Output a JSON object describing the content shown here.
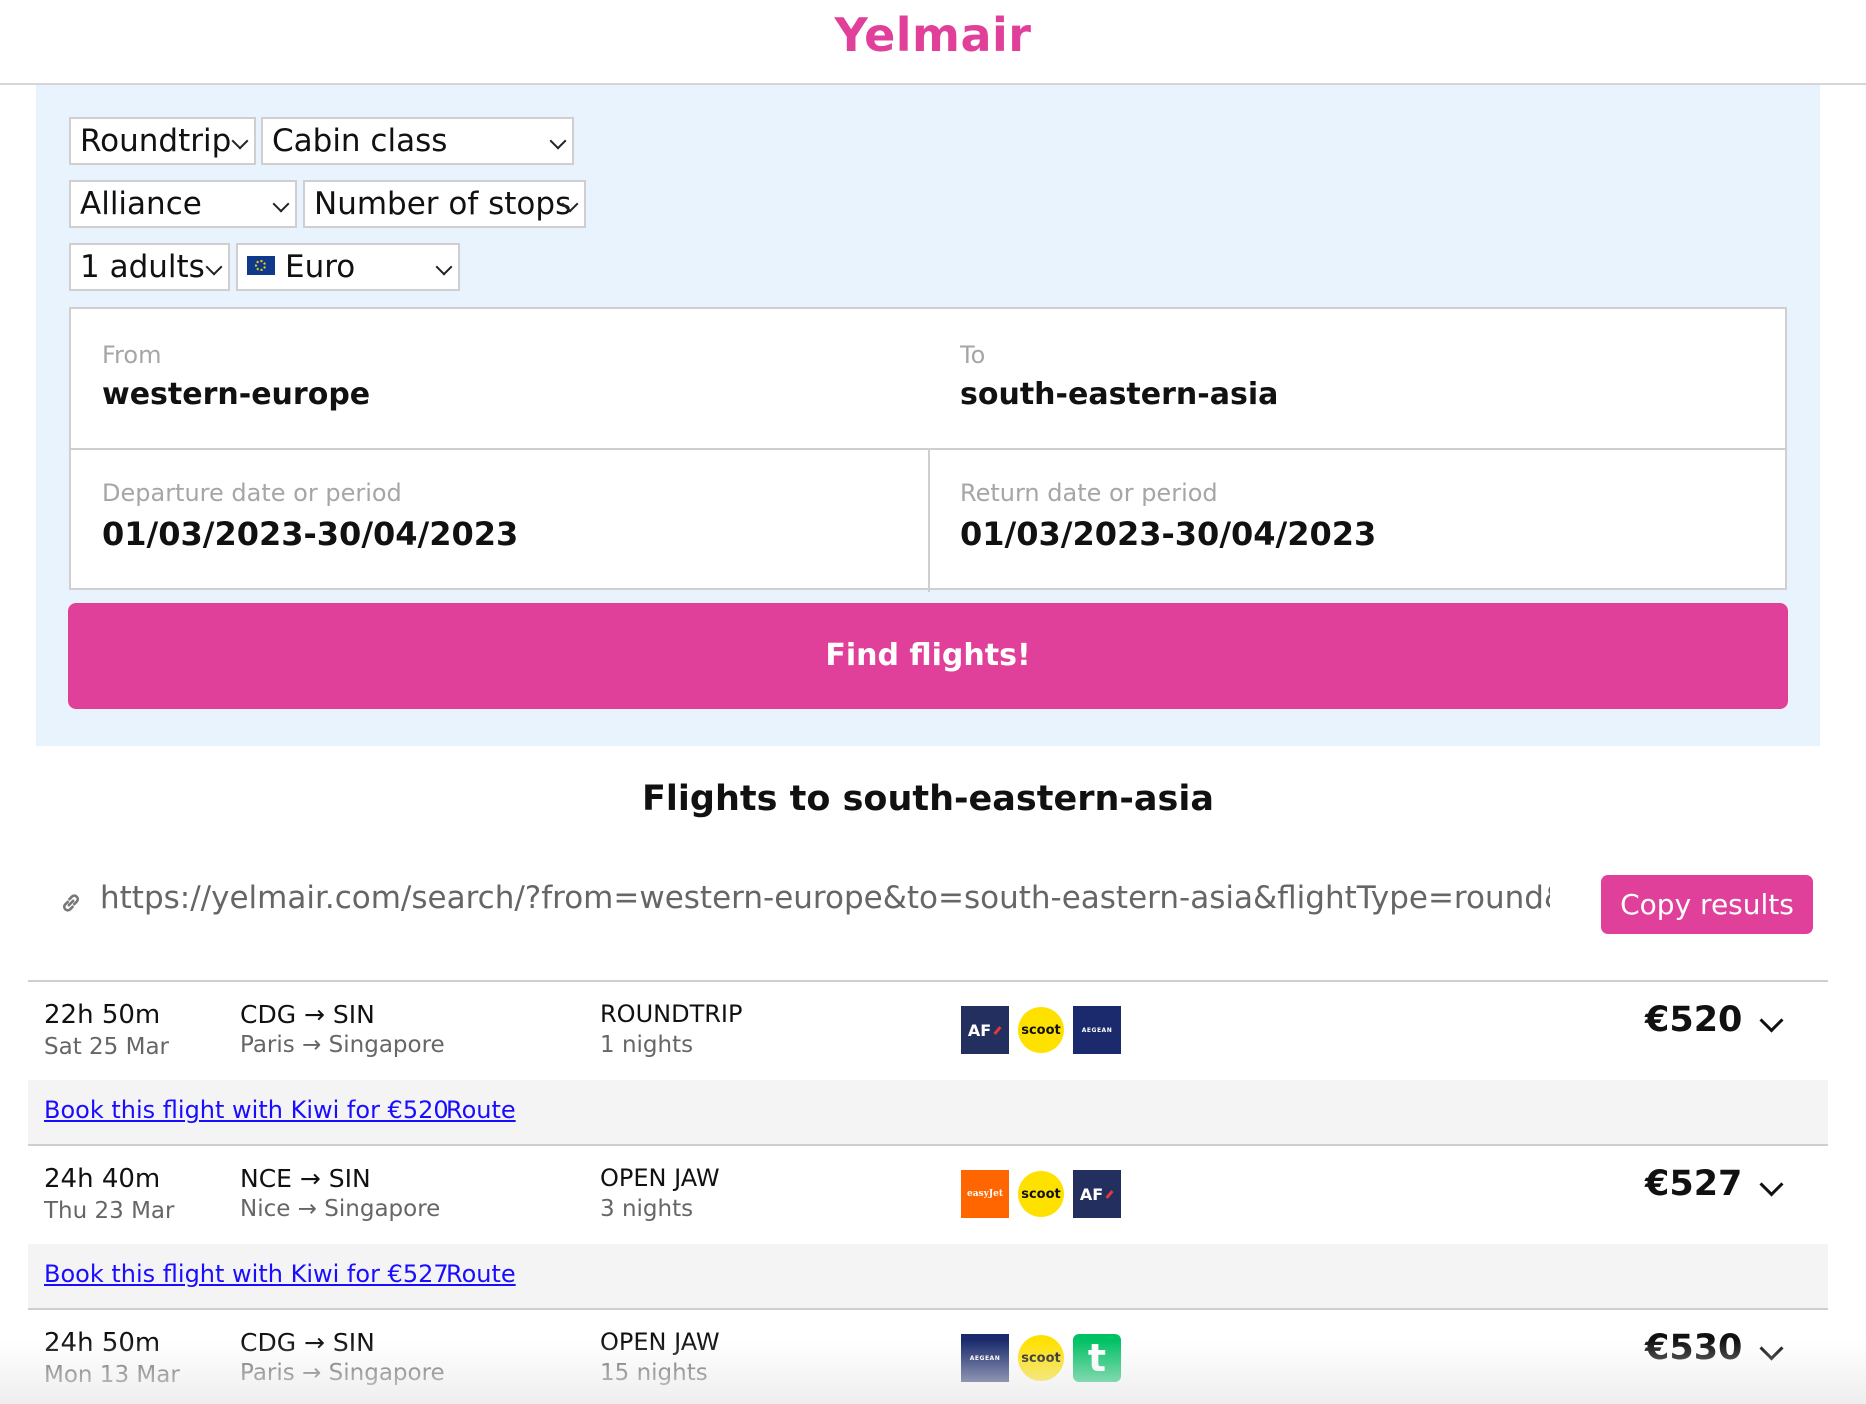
{
  "header": {
    "logo": "Yelmair"
  },
  "search": {
    "trip_type": "Roundtrip",
    "cabin_class": "Cabin class",
    "alliance": "Alliance",
    "stops": "Number of stops",
    "passengers": "1 adults",
    "currency": "Euro",
    "from_label": "From",
    "from_value": "western-europe",
    "to_label": "To",
    "to_value": "south-eastern-asia",
    "departure_label": "Departure date or period",
    "departure_value": "01/03/2023-30/04/2023",
    "return_label": "Return date or period",
    "return_value": "01/03/2023-30/04/2023",
    "find_button": "Find flights!"
  },
  "results": {
    "title": "Flights to south-eastern-asia",
    "share_url": "https://yelmair.com/search/?from=western-europe&to=south-eastern-asia&flightType=round&alliance",
    "copy_button": "Copy results",
    "items": [
      {
        "duration": "22h 50m",
        "date": "Sat 25 Mar",
        "codes": "CDG → SIN",
        "cities": "Paris → Singapore",
        "type": "ROUNDTRIP",
        "nights": "1 nights",
        "airlines": [
          "air-france",
          "scoot",
          "aegean"
        ],
        "price": "€520",
        "book_link": "Book this flight with Kiwi for €520",
        "route_link": "Route"
      },
      {
        "duration": "24h 40m",
        "date": "Thu 23 Mar",
        "codes": "NCE → SIN",
        "cities": "Nice → Singapore",
        "type": "OPEN JAW",
        "nights": "3 nights",
        "airlines": [
          "easyjet",
          "scoot",
          "air-france"
        ],
        "price": "€527",
        "book_link": "Book this flight with Kiwi for €527",
        "route_link": "Route"
      },
      {
        "duration": "24h 50m",
        "date": "Mon 13 Mar",
        "codes": "CDG → SIN",
        "cities": "Paris → Singapore",
        "type": "OPEN JAW",
        "nights": "15 nights",
        "airlines": [
          "aegean",
          "scoot",
          "transavia"
        ],
        "price": "€530"
      }
    ]
  },
  "logo_text": {
    "af": "AF",
    "scoot": "scoot",
    "aegean": "AEGEAN",
    "easyjet": "easyJet",
    "transavia": "t"
  },
  "colors": {
    "brand": "#e0409a",
    "panel_bg": "#e8f3fd",
    "link": "#1a0dff"
  }
}
